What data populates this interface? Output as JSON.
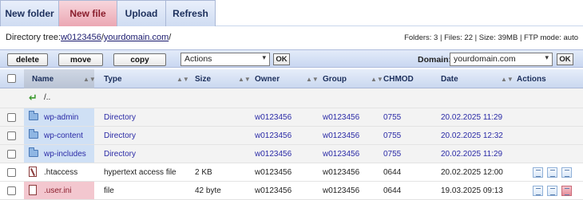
{
  "toolbar": {
    "tabs": [
      "New folder",
      "New file",
      "Upload",
      "Refresh"
    ]
  },
  "directory": {
    "label": "Directory tree: ",
    "root_link": "w0123456",
    "sep": "/",
    "sub_link": "yourdomain.com",
    "trail": "/",
    "stats": "Folders: 3 | Files: 22 | Size: 39MB | FTP mode: auto"
  },
  "actions": {
    "delete": "delete",
    "move": "move",
    "copy": "copy",
    "actions_select": "Actions",
    "ok": "OK",
    "domain_label": "Domain:",
    "domain_value": "yourdomain.com",
    "domain_ok": "OK"
  },
  "table": {
    "columns": [
      "Name",
      "Type",
      "Size",
      "Owner",
      "Group",
      "CHMOD",
      "Date",
      "Actions"
    ],
    "up": "/..",
    "rows": [
      {
        "name": "wp-admin",
        "type": "Directory",
        "size": "",
        "owner": "w0123456",
        "group": "w0123456",
        "chmod": "0755",
        "date": "20.02.2025 11:29",
        "kind": "dir"
      },
      {
        "name": "wp-content",
        "type": "Directory",
        "size": "",
        "owner": "w0123456",
        "group": "w0123456",
        "chmod": "0755",
        "date": "20.02.2025 12:32",
        "kind": "dir"
      },
      {
        "name": "wp-includes",
        "type": "Directory",
        "size": "",
        "owner": "w0123456",
        "group": "w0123456",
        "chmod": "0755",
        "date": "20.02.2025 11:29",
        "kind": "dir"
      },
      {
        "name": ".htaccess",
        "type": "hypertext access file",
        "size": "2 KB",
        "owner": "w0123456",
        "group": "w0123456",
        "chmod": "0644",
        "date": "20.02.2025 12:00",
        "kind": "file"
      },
      {
        "name": ".user.ini",
        "type": "file",
        "size": "42 byte",
        "owner": "w0123456",
        "group": "w0123456",
        "chmod": "0644",
        "date": "19.03.2025 09:13",
        "kind": "file"
      }
    ]
  },
  "colors": {
    "tab_active": "#eba7b3",
    "link_blue": "#2a2aa6",
    "header_blue": "#cad8f0"
  }
}
